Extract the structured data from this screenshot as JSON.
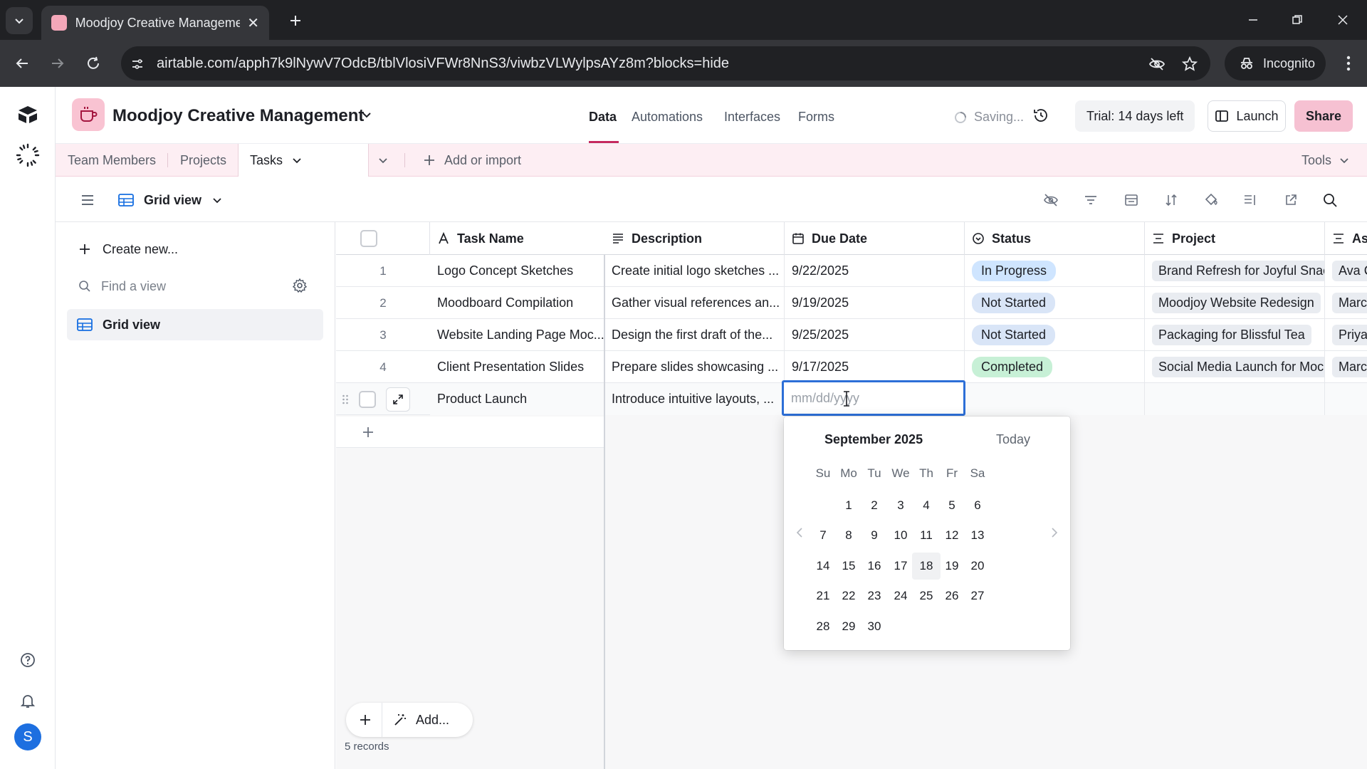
{
  "browser": {
    "tab_title": "Moodjoy Creative Management",
    "url": "airtable.com/apph7k9lNywV7OdcB/tblVlosiVFWr8NnS3/viwbzVLWylpsAYz8m?blocks=hide",
    "incognito_label": "Incognito"
  },
  "app": {
    "base_name": "Moodjoy Creative Management",
    "nav_tabs": [
      {
        "label": "Data",
        "active": true
      },
      {
        "label": "Automations",
        "active": false
      },
      {
        "label": "Interfaces",
        "active": false
      },
      {
        "label": "Forms",
        "active": false
      }
    ],
    "saving_label": "Saving...",
    "trial_label": "Trial: 14 days left",
    "launch_label": "Launch",
    "share_label": "Share",
    "avatar_initial": "S",
    "accent_color": "#c5295e"
  },
  "tables": {
    "tabs": [
      "Team Members",
      "Projects",
      "Tasks"
    ],
    "active_tab": "Tasks",
    "add_import_label": "Add or import",
    "tools_label": "Tools"
  },
  "view": {
    "name": "Grid view"
  },
  "sidebar": {
    "create_new": "Create new...",
    "find_placeholder": "Find a view",
    "views": [
      "Grid view"
    ]
  },
  "grid": {
    "columns": [
      "Task Name",
      "Description",
      "Due Date",
      "Status",
      "Project",
      "Assignee"
    ],
    "rows": [
      {
        "num": "1",
        "task": "Logo Concept Sketches",
        "description": "Create initial logo sketches ...",
        "due": "9/22/2025",
        "status": "In Progress",
        "project": "Brand Refresh for Joyful Snac",
        "assignee": "Ava C"
      },
      {
        "num": "2",
        "task": "Moodboard Compilation",
        "description": "Gather visual references an...",
        "due": "9/19/2025",
        "status": "Not Started",
        "project": "Moodjoy Website Redesign",
        "assignee": "Marcu"
      },
      {
        "num": "3",
        "task": "Website Landing Page Moc...",
        "description": "Design the first draft of the...",
        "due": "9/25/2025",
        "status": "Not Started",
        "project": "Packaging for Blissful Tea",
        "assignee": "Priya"
      },
      {
        "num": "4",
        "task": "Client Presentation Slides",
        "description": "Prepare slides showcasing ...",
        "due": "9/17/2025",
        "status": "Completed",
        "project": "Social Media Launch for Moc",
        "assignee": "Marcu"
      },
      {
        "num": "",
        "task": "Product Launch",
        "description": "Introduce intuitive layouts, ...",
        "due": "",
        "status": "",
        "project": "",
        "assignee": ""
      }
    ],
    "date_placeholder": "mm/dd/yyyy",
    "record_count": "5 records",
    "add_label": "Add..."
  },
  "datepicker": {
    "month_label": "September 2025",
    "today_label": "Today",
    "weekdays": [
      "Su",
      "Mo",
      "Tu",
      "We",
      "Th",
      "Fr",
      "Sa"
    ],
    "days": [
      "1",
      "2",
      "3",
      "4",
      "5",
      "6",
      "7",
      "8",
      "9",
      "10",
      "11",
      "12",
      "13",
      "14",
      "15",
      "16",
      "17",
      "18",
      "19",
      "20",
      "21",
      "22",
      "23",
      "24",
      "25",
      "26",
      "27",
      "28",
      "29",
      "30"
    ],
    "today": "18"
  }
}
